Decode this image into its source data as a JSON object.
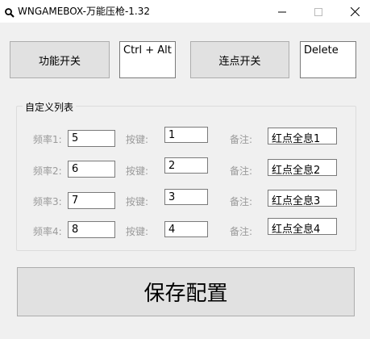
{
  "window": {
    "title": "WNGAMEBOX-万能压枪-1.32",
    "controls": [
      "minimize",
      "maximize",
      "close"
    ]
  },
  "toolbar": {
    "func_toggle_label": "功能开关",
    "func_hotkey_value": "Ctrl + Alt + ",
    "burst_toggle_label": "连点开关",
    "burst_hotkey_value": "Delete"
  },
  "custom_list": {
    "title": "自定义列表",
    "rows": [
      {
        "freq_label": "频率1:",
        "freq_value": "5",
        "key_label": "按键:",
        "key_value": "1",
        "note_label": "备注:",
        "note_value": "红点全息1"
      },
      {
        "freq_label": "频率2:",
        "freq_value": "6",
        "key_label": "按键:",
        "key_value": "2",
        "note_label": "备注:",
        "note_value": "红点全息2"
      },
      {
        "freq_label": "频率3:",
        "freq_value": "7",
        "key_label": "按键:",
        "key_value": "3",
        "note_label": "备注:",
        "note_value": "红点全息3"
      },
      {
        "freq_label": "频率4:",
        "freq_value": "8",
        "key_label": "按键:",
        "key_value": "4",
        "note_label": "备注:",
        "note_value": "红点全息4"
      }
    ]
  },
  "footer": {
    "save_label": "保存配置"
  }
}
